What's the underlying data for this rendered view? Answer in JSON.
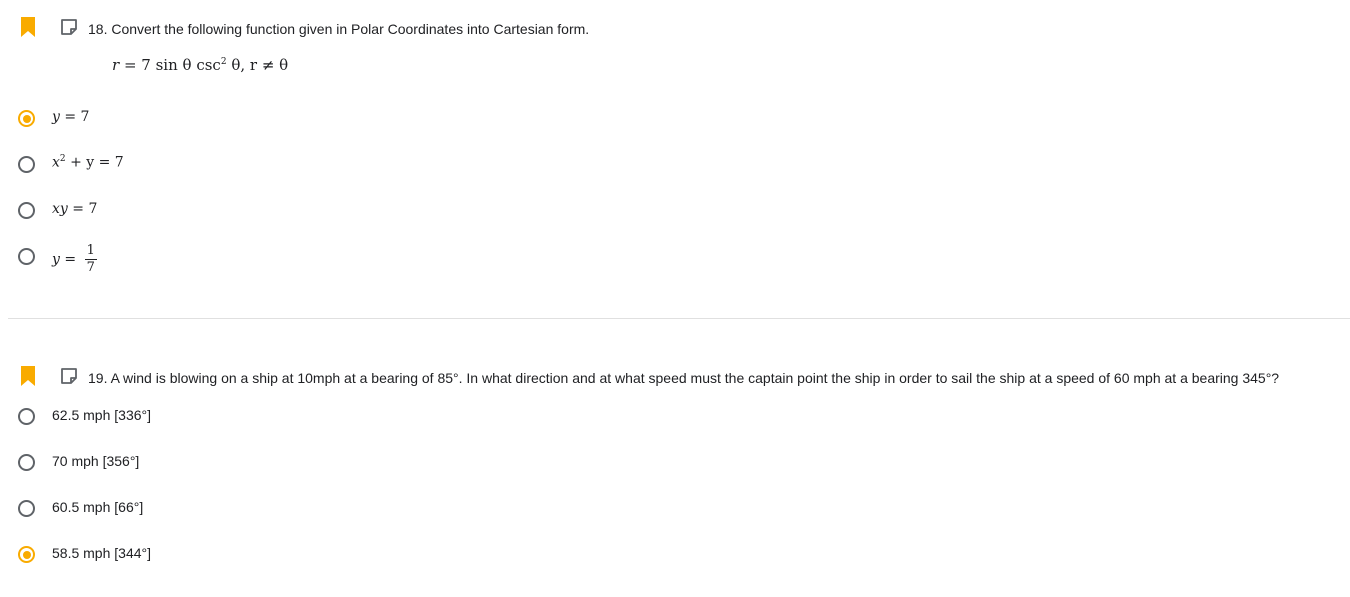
{
  "accent_color": "#f9ab00",
  "questions": [
    {
      "number_text": "18. Convert the following function given in Polar Coordinates into Cartesian form.",
      "equation": {
        "lhs": "r",
        "rhs_prefix": "= 7 sin θ csc",
        "power": "2",
        "rhs_suffix": " θ, r ≠ θ"
      },
      "options": [
        {
          "lhs": "y",
          "rhs": "= 7",
          "selected": true
        },
        {
          "lhs": "x",
          "power": "2",
          "rhs": " + y = 7",
          "selected": false
        },
        {
          "lhs": "xy",
          "rhs": "= 7",
          "selected": false
        },
        {
          "lhs": "y",
          "rhs": "=",
          "frac_num": "1",
          "frac_den": "7",
          "selected": false
        }
      ]
    },
    {
      "number_text": "19. A wind is blowing on a ship at 10mph at a bearing of 85°. In what direction and at what speed must the captain point the ship in order to sail the ship at a speed of 60 mph at a bearing 345°?",
      "options": [
        {
          "label": "62.5 mph [336°]",
          "selected": false
        },
        {
          "label": "70 mph [356°]",
          "selected": false
        },
        {
          "label": "60.5 mph [66°]",
          "selected": false
        },
        {
          "label": "58.5 mph [344°]",
          "selected": true
        }
      ]
    }
  ]
}
